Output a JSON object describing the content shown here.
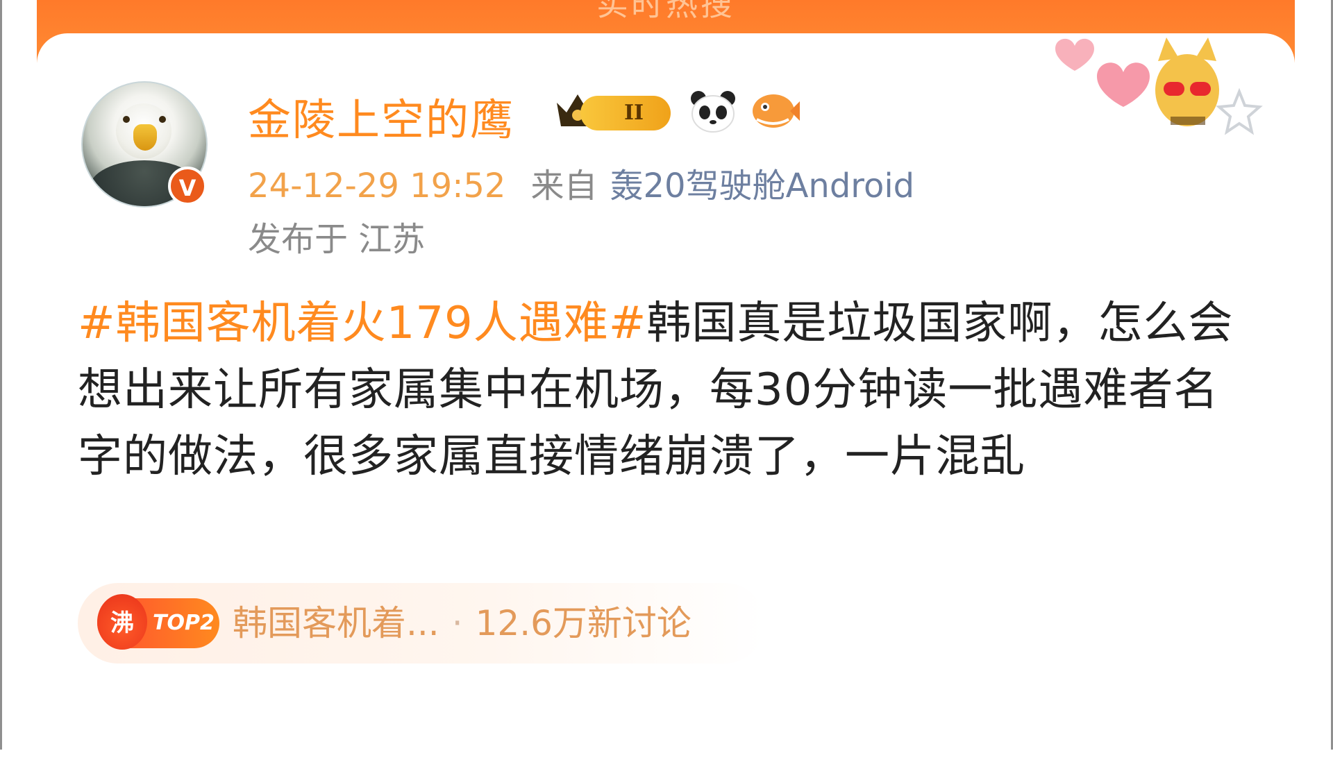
{
  "header": {
    "title": "实时热搜"
  },
  "post": {
    "author": {
      "name": "金陵上空的鹰",
      "avatar_icon": "eagle-avatar",
      "verified_badge": "V",
      "level_badge": "II"
    },
    "time": "24-12-29 19:52",
    "from_label": "来自",
    "device": "轰20驾驶舱Android",
    "location": "发布于 江苏",
    "hashtag": "#韩国客机着火179人遇难#",
    "body": "韩国真是垃圾国家啊，怎么会想出来让所有家属集中在机场，每30分钟读一批遇难者名字的做法，很多家属直接情绪崩溃了，一片混乱"
  },
  "topic": {
    "hot_icon": "沸",
    "rank_label": "TOP2",
    "title": "韩国客机着...",
    "separator": "·",
    "count": "12.6万新讨论"
  },
  "colors": {
    "accent": "#ff8a1f",
    "header_bar": "#ff7a2a",
    "meta_gray": "#8a8a8a",
    "device_blue": "#6d7fa0",
    "verified": "#ea5a1a"
  }
}
